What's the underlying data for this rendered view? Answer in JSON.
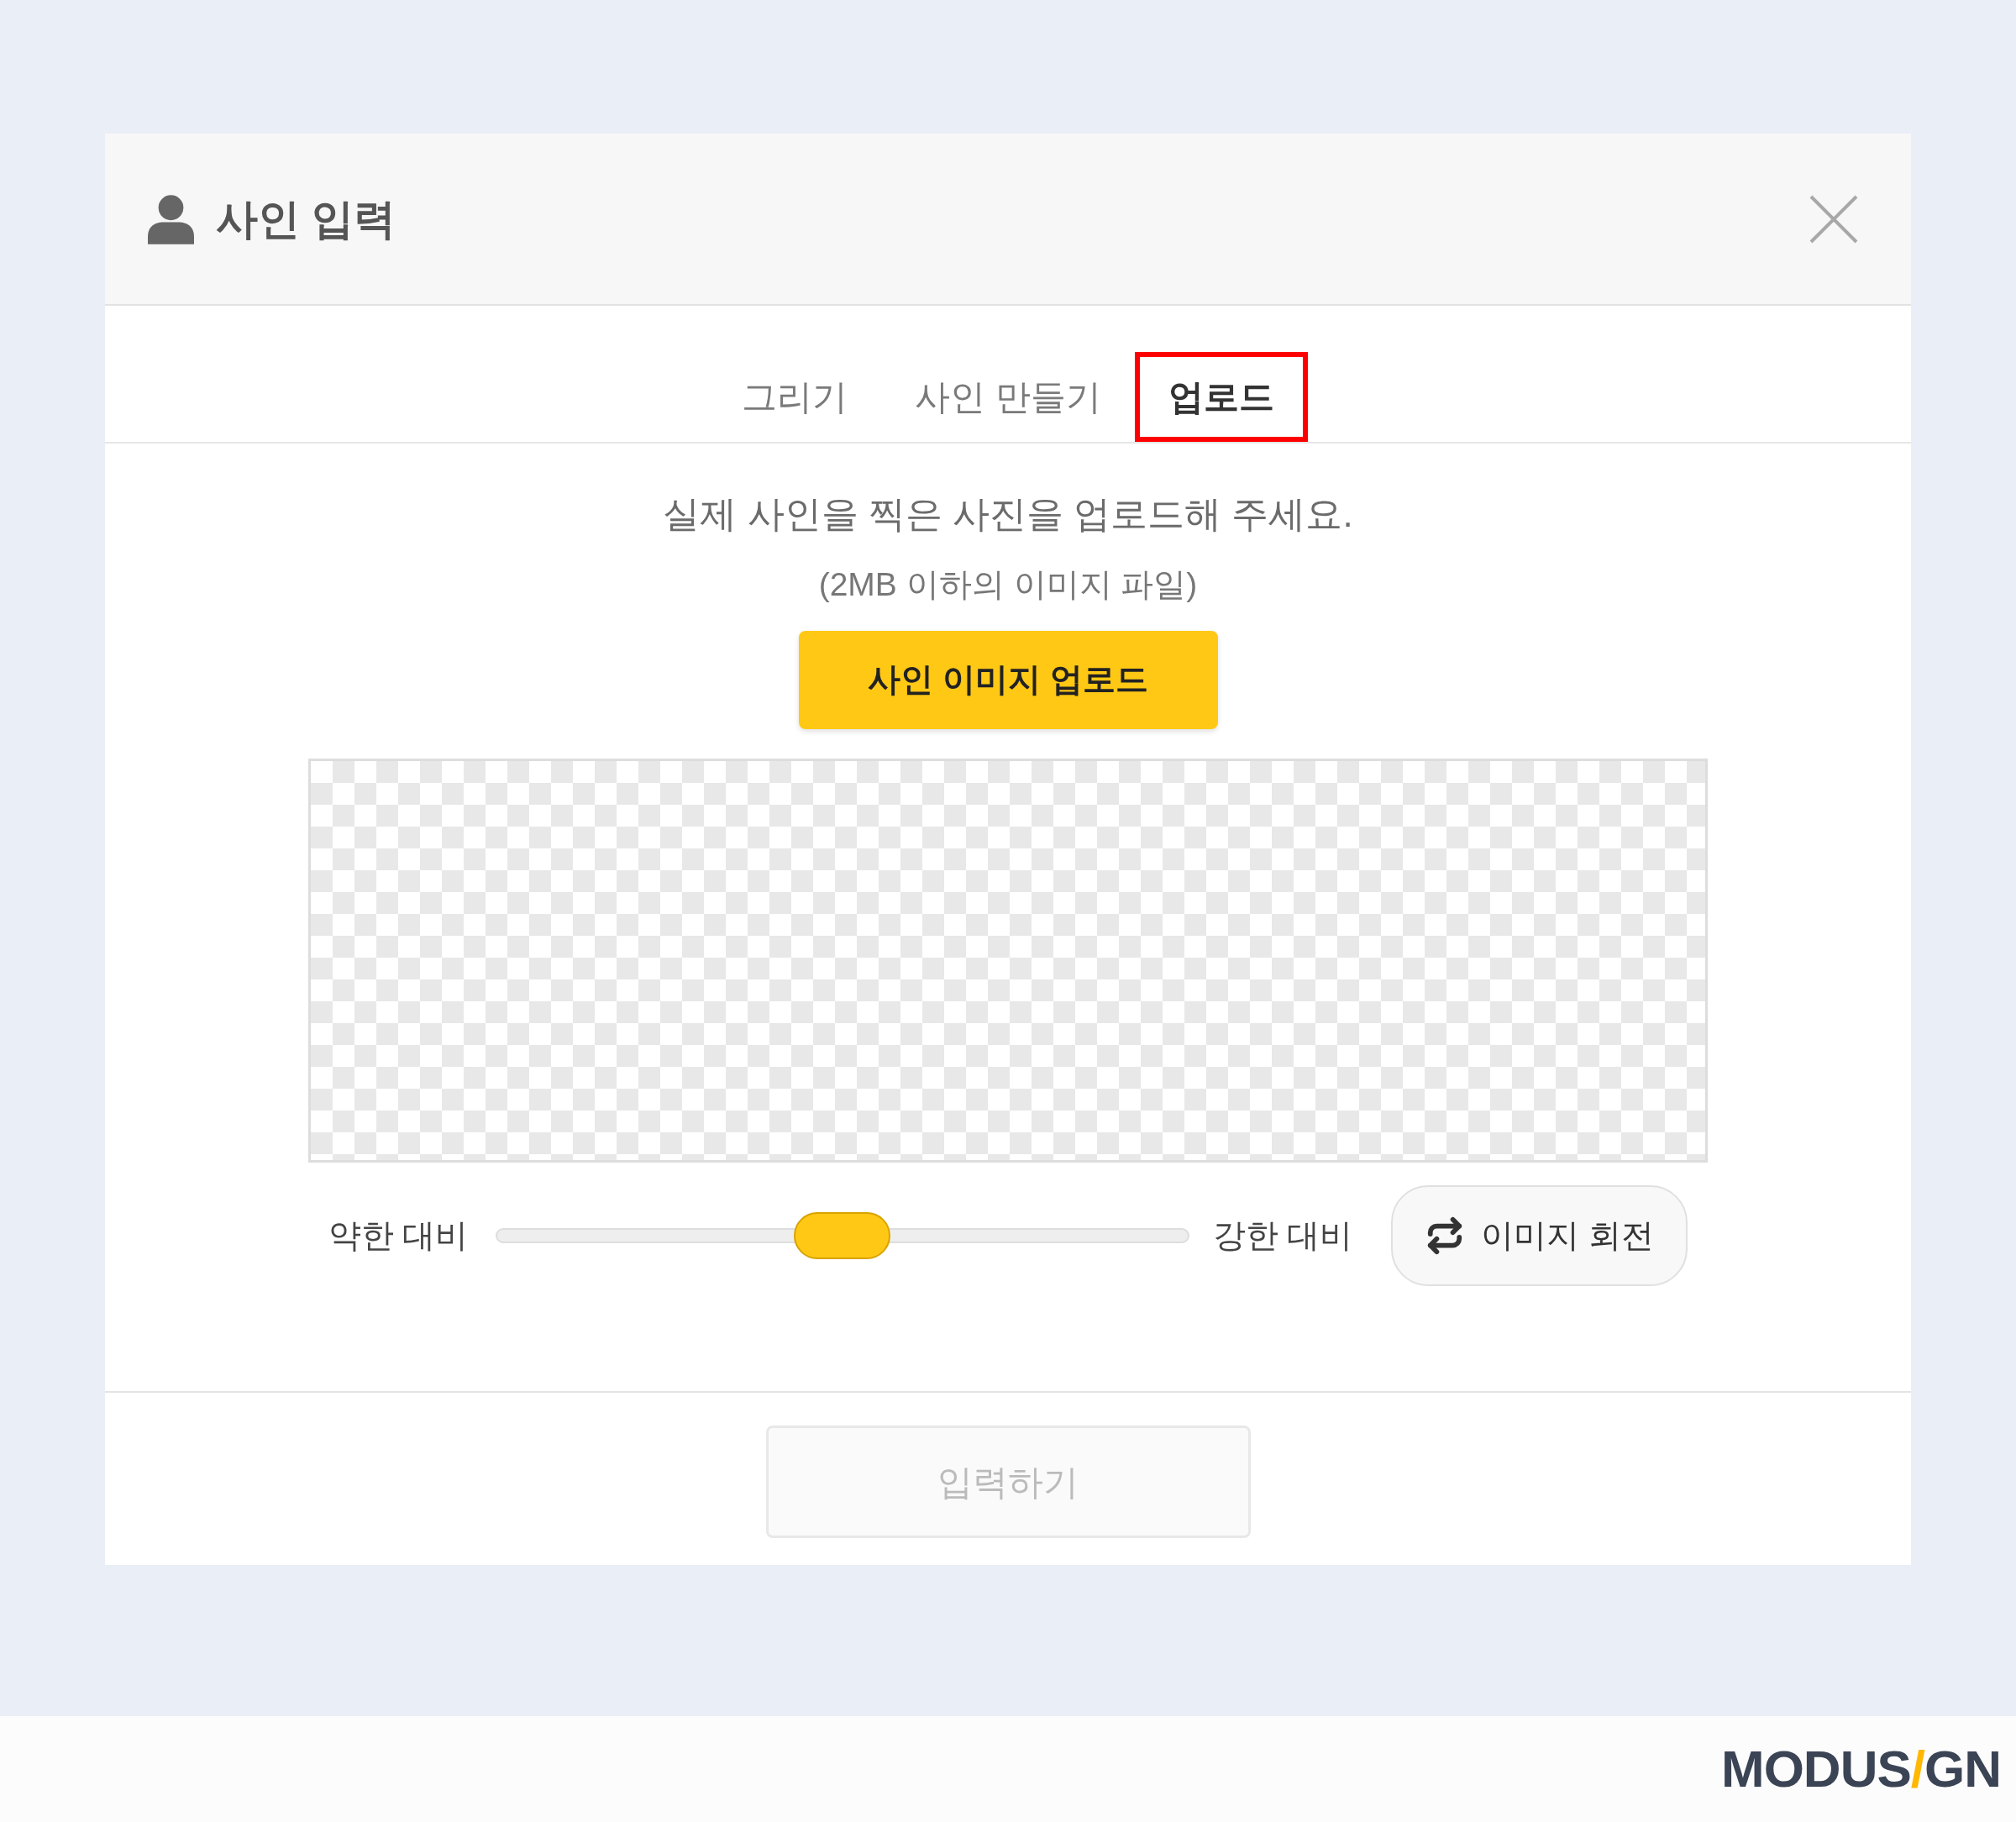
{
  "dialog": {
    "title": "사인 입력"
  },
  "tabs": [
    {
      "label": "그리기",
      "selected": false,
      "highlighted": false
    },
    {
      "label": "사인 만들기",
      "selected": false,
      "highlighted": false
    },
    {
      "label": "업로드",
      "selected": true,
      "highlighted": true
    }
  ],
  "upload": {
    "instruction": "실제 사인을 찍은 사진을 업로드해 주세요.",
    "note": "(2MB 이하의 이미지 파일)",
    "button": "사인 이미지 업로드"
  },
  "contrast": {
    "min_label": "약한 대비",
    "max_label": "강한 대비",
    "level": 0.5
  },
  "rotate_button": "이미지 회전",
  "submit_button": {
    "label": "입력하기",
    "disabled": true
  },
  "logo": {
    "parts": [
      "MODUS",
      "/",
      "GN"
    ]
  }
}
